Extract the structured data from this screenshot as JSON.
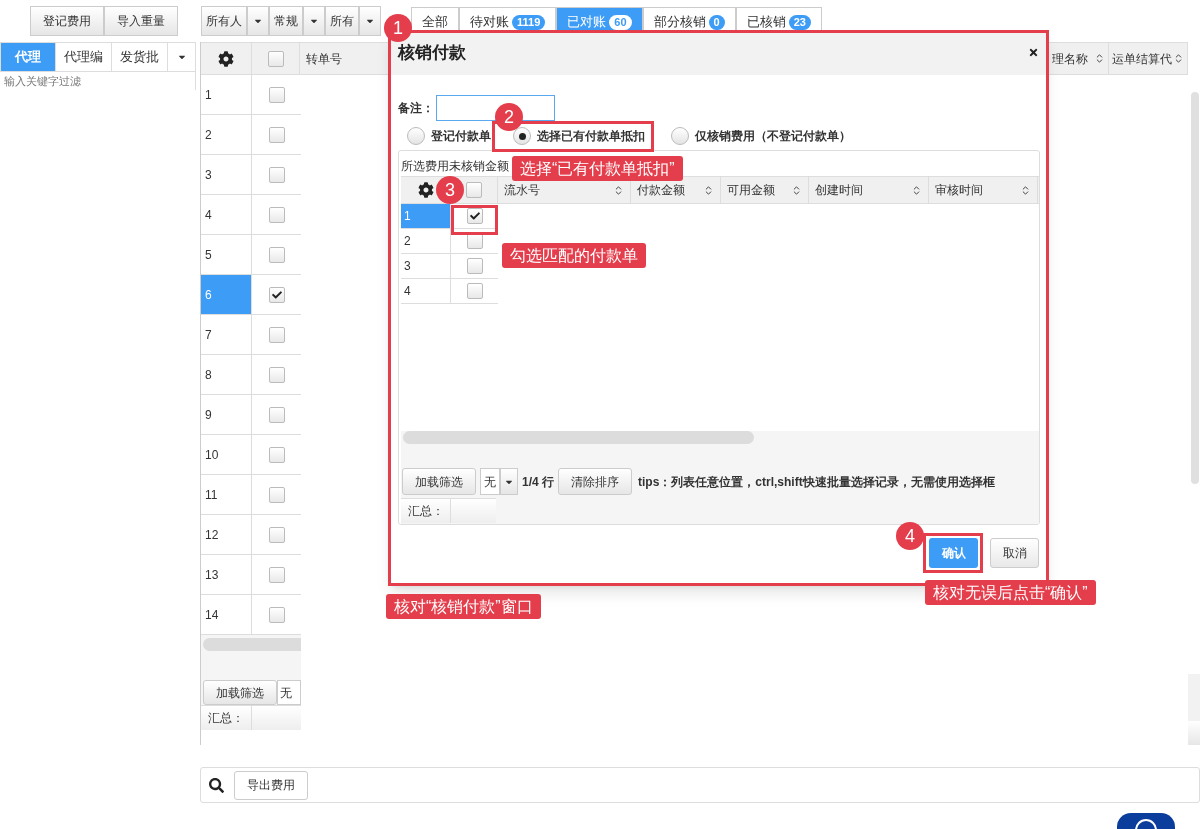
{
  "toolbar": {
    "buttons": [
      "登记费用",
      "导入重量"
    ],
    "filters": [
      "所有人",
      "常规",
      "所有"
    ]
  },
  "status_tabs": [
    {
      "label": "全部",
      "selected": false
    },
    {
      "label": "待对账",
      "count": "1119",
      "selected": false
    },
    {
      "label": "已对账",
      "count": "60",
      "selected": true
    },
    {
      "label": "部分核销",
      "count": "0",
      "selected": false
    },
    {
      "label": "已核销",
      "count": "23",
      "selected": false
    }
  ],
  "left_panel": {
    "tabs": [
      {
        "label": "代理",
        "selected": true
      },
      {
        "label": "代理编",
        "selected": false
      },
      {
        "label": "发货批",
        "selected": false
      }
    ],
    "filter": {
      "placeholder": "输入关键字过滤"
    }
  },
  "grid": {
    "all_checked": false,
    "columns": [
      "转单号",
      "理名称",
      "运单结算代"
    ],
    "rows": [
      {
        "number": "1",
        "checked": false,
        "selected": false
      },
      {
        "number": "2",
        "checked": false,
        "selected": false
      },
      {
        "number": "3",
        "checked": false,
        "selected": false
      },
      {
        "number": "4",
        "checked": false,
        "selected": false
      },
      {
        "number": "5",
        "checked": false,
        "selected": false
      },
      {
        "number": "6",
        "checked": true,
        "selected": true
      },
      {
        "number": "7",
        "checked": false,
        "selected": false
      },
      {
        "number": "8",
        "checked": false,
        "selected": false
      },
      {
        "number": "9",
        "checked": false,
        "selected": false
      },
      {
        "number": "10",
        "checked": false,
        "selected": false
      },
      {
        "number": "11",
        "checked": false,
        "selected": false
      },
      {
        "number": "12",
        "checked": false,
        "selected": false
      },
      {
        "number": "13",
        "checked": false,
        "selected": false
      },
      {
        "number": "14",
        "checked": false,
        "selected": false
      }
    ],
    "footer": {
      "load_button": "加载筛选",
      "page_size": "无",
      "summary_label": "汇总："
    }
  },
  "bottom_bar": {
    "export_button": "导出费用"
  },
  "dialog": {
    "title": "核销付款",
    "remark_label": "备注：",
    "payment_options": [
      {
        "label": "登记付款单",
        "selected": false
      },
      {
        "label": "选择已有付款单抵扣",
        "selected": true
      },
      {
        "label": "仅核销费用（不登记付款单）",
        "selected": false
      }
    ],
    "summary_text": "所选费用未核销金额",
    "table": {
      "all_checked": false,
      "columns": [
        "流水号",
        "付款金额",
        "可用金额",
        "创建时间",
        "审核时间"
      ],
      "rows": [
        {
          "number": "1",
          "checked": true,
          "selected": true
        },
        {
          "number": "2",
          "checked": false,
          "selected": false
        },
        {
          "number": "3",
          "checked": false,
          "selected": false
        },
        {
          "number": "4",
          "checked": false,
          "selected": false
        }
      ]
    },
    "footer": {
      "load_button": "加载筛选",
      "page_size": "无",
      "row_count": "1/4 行",
      "clear_sort_button": "清除排序",
      "tips": "tips：列表任意位置，ctrl,shift快速批量选择记录，无需使用选择框",
      "summary_label": "汇总："
    },
    "buttons": [
      {
        "label": "确认",
        "kind": "primary"
      },
      {
        "label": "取消",
        "kind": "default"
      }
    ]
  },
  "annotations": [
    {
      "number": "1",
      "caption": "核对“核销付款”窗口"
    },
    {
      "number": "2",
      "caption": "选择“已有付款单抵扣”"
    },
    {
      "number": "3",
      "caption": "勾选匹配的付款单"
    },
    {
      "number": "4",
      "caption": "核对无误后点击“确认”"
    }
  ]
}
